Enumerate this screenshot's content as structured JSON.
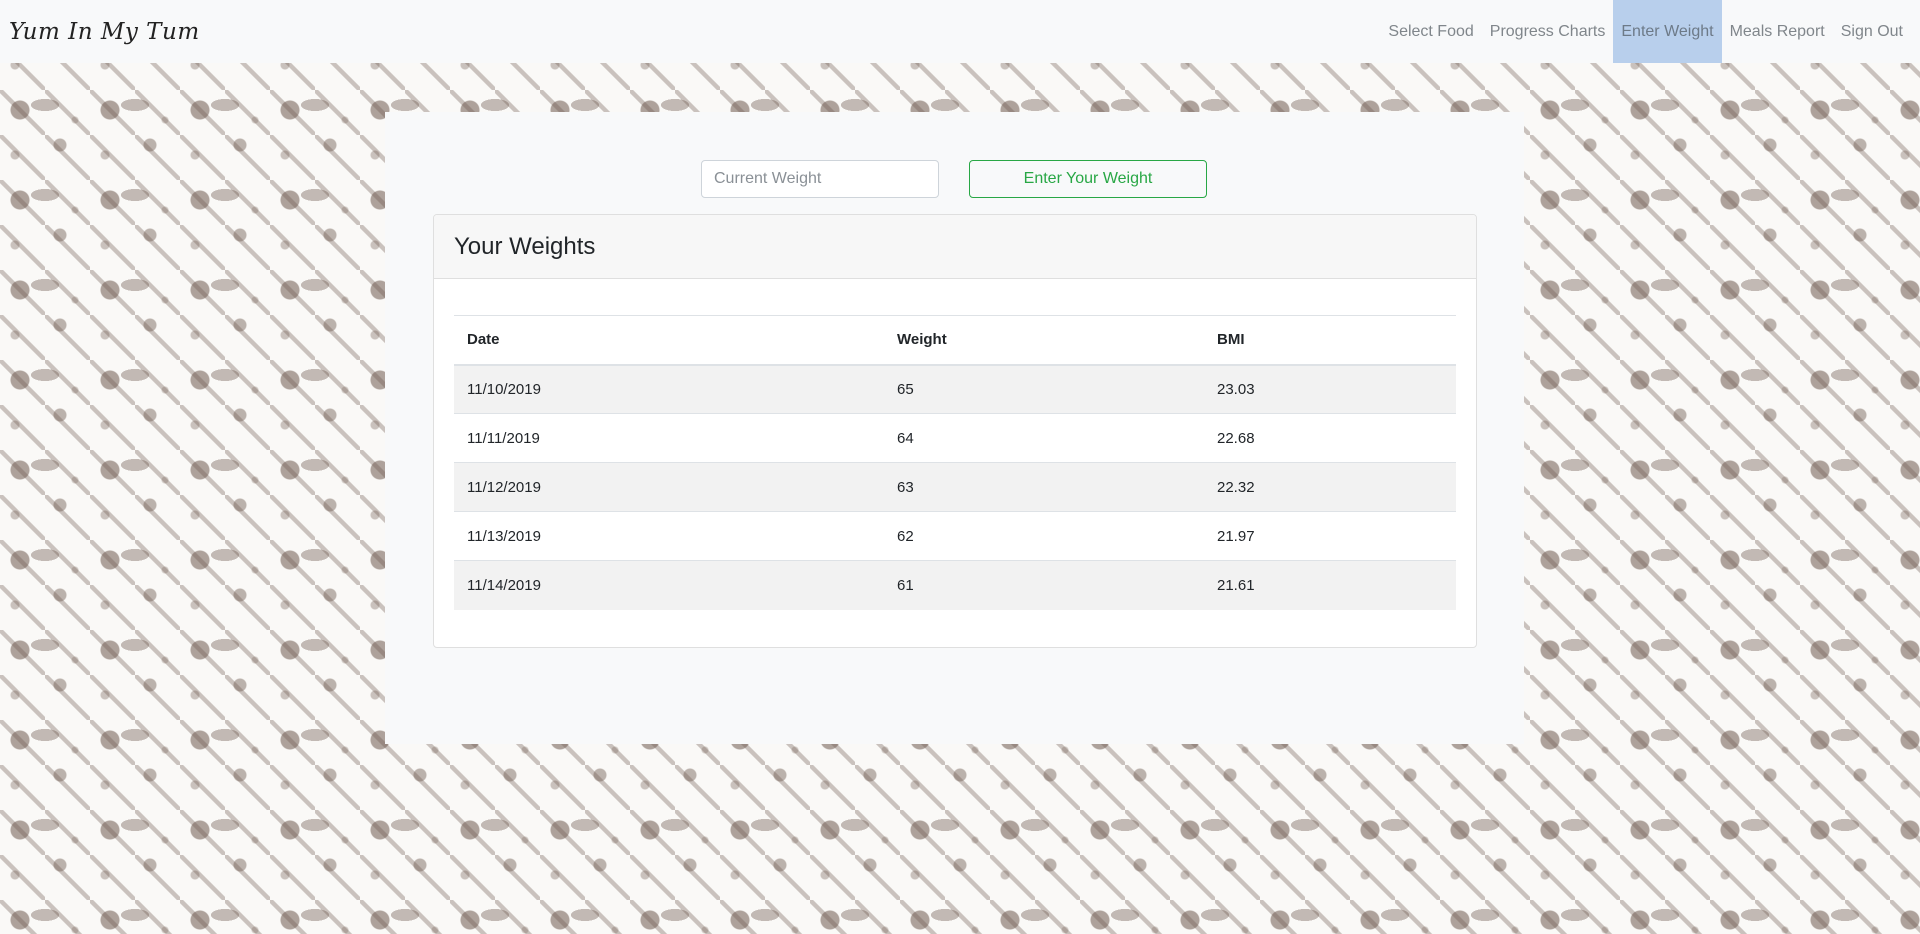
{
  "navbar": {
    "brand": "Yum In My Tum",
    "links": [
      {
        "label": "Select Food",
        "active": false
      },
      {
        "label": "Progress Charts",
        "active": false
      },
      {
        "label": "Enter Weight",
        "active": true
      },
      {
        "label": "Meals Report",
        "active": false
      },
      {
        "label": "Sign Out",
        "active": false
      }
    ]
  },
  "form": {
    "weight_placeholder": "Current Weight",
    "weight_value": "",
    "submit_label": "Enter Your Weight"
  },
  "weights": {
    "title": "Your Weights",
    "columns": [
      "Date",
      "Weight",
      "BMI"
    ],
    "rows": [
      [
        "11/10/2019",
        "65",
        "23.03"
      ],
      [
        "11/11/2019",
        "64",
        "22.68"
      ],
      [
        "11/12/2019",
        "63",
        "22.32"
      ],
      [
        "11/13/2019",
        "62",
        "21.97"
      ],
      [
        "11/14/2019",
        "61",
        "21.61"
      ]
    ]
  },
  "colors": {
    "navbar_bg": "#f8f9fa",
    "active_link_bg": "#b8cfec",
    "success": "#28a745"
  }
}
